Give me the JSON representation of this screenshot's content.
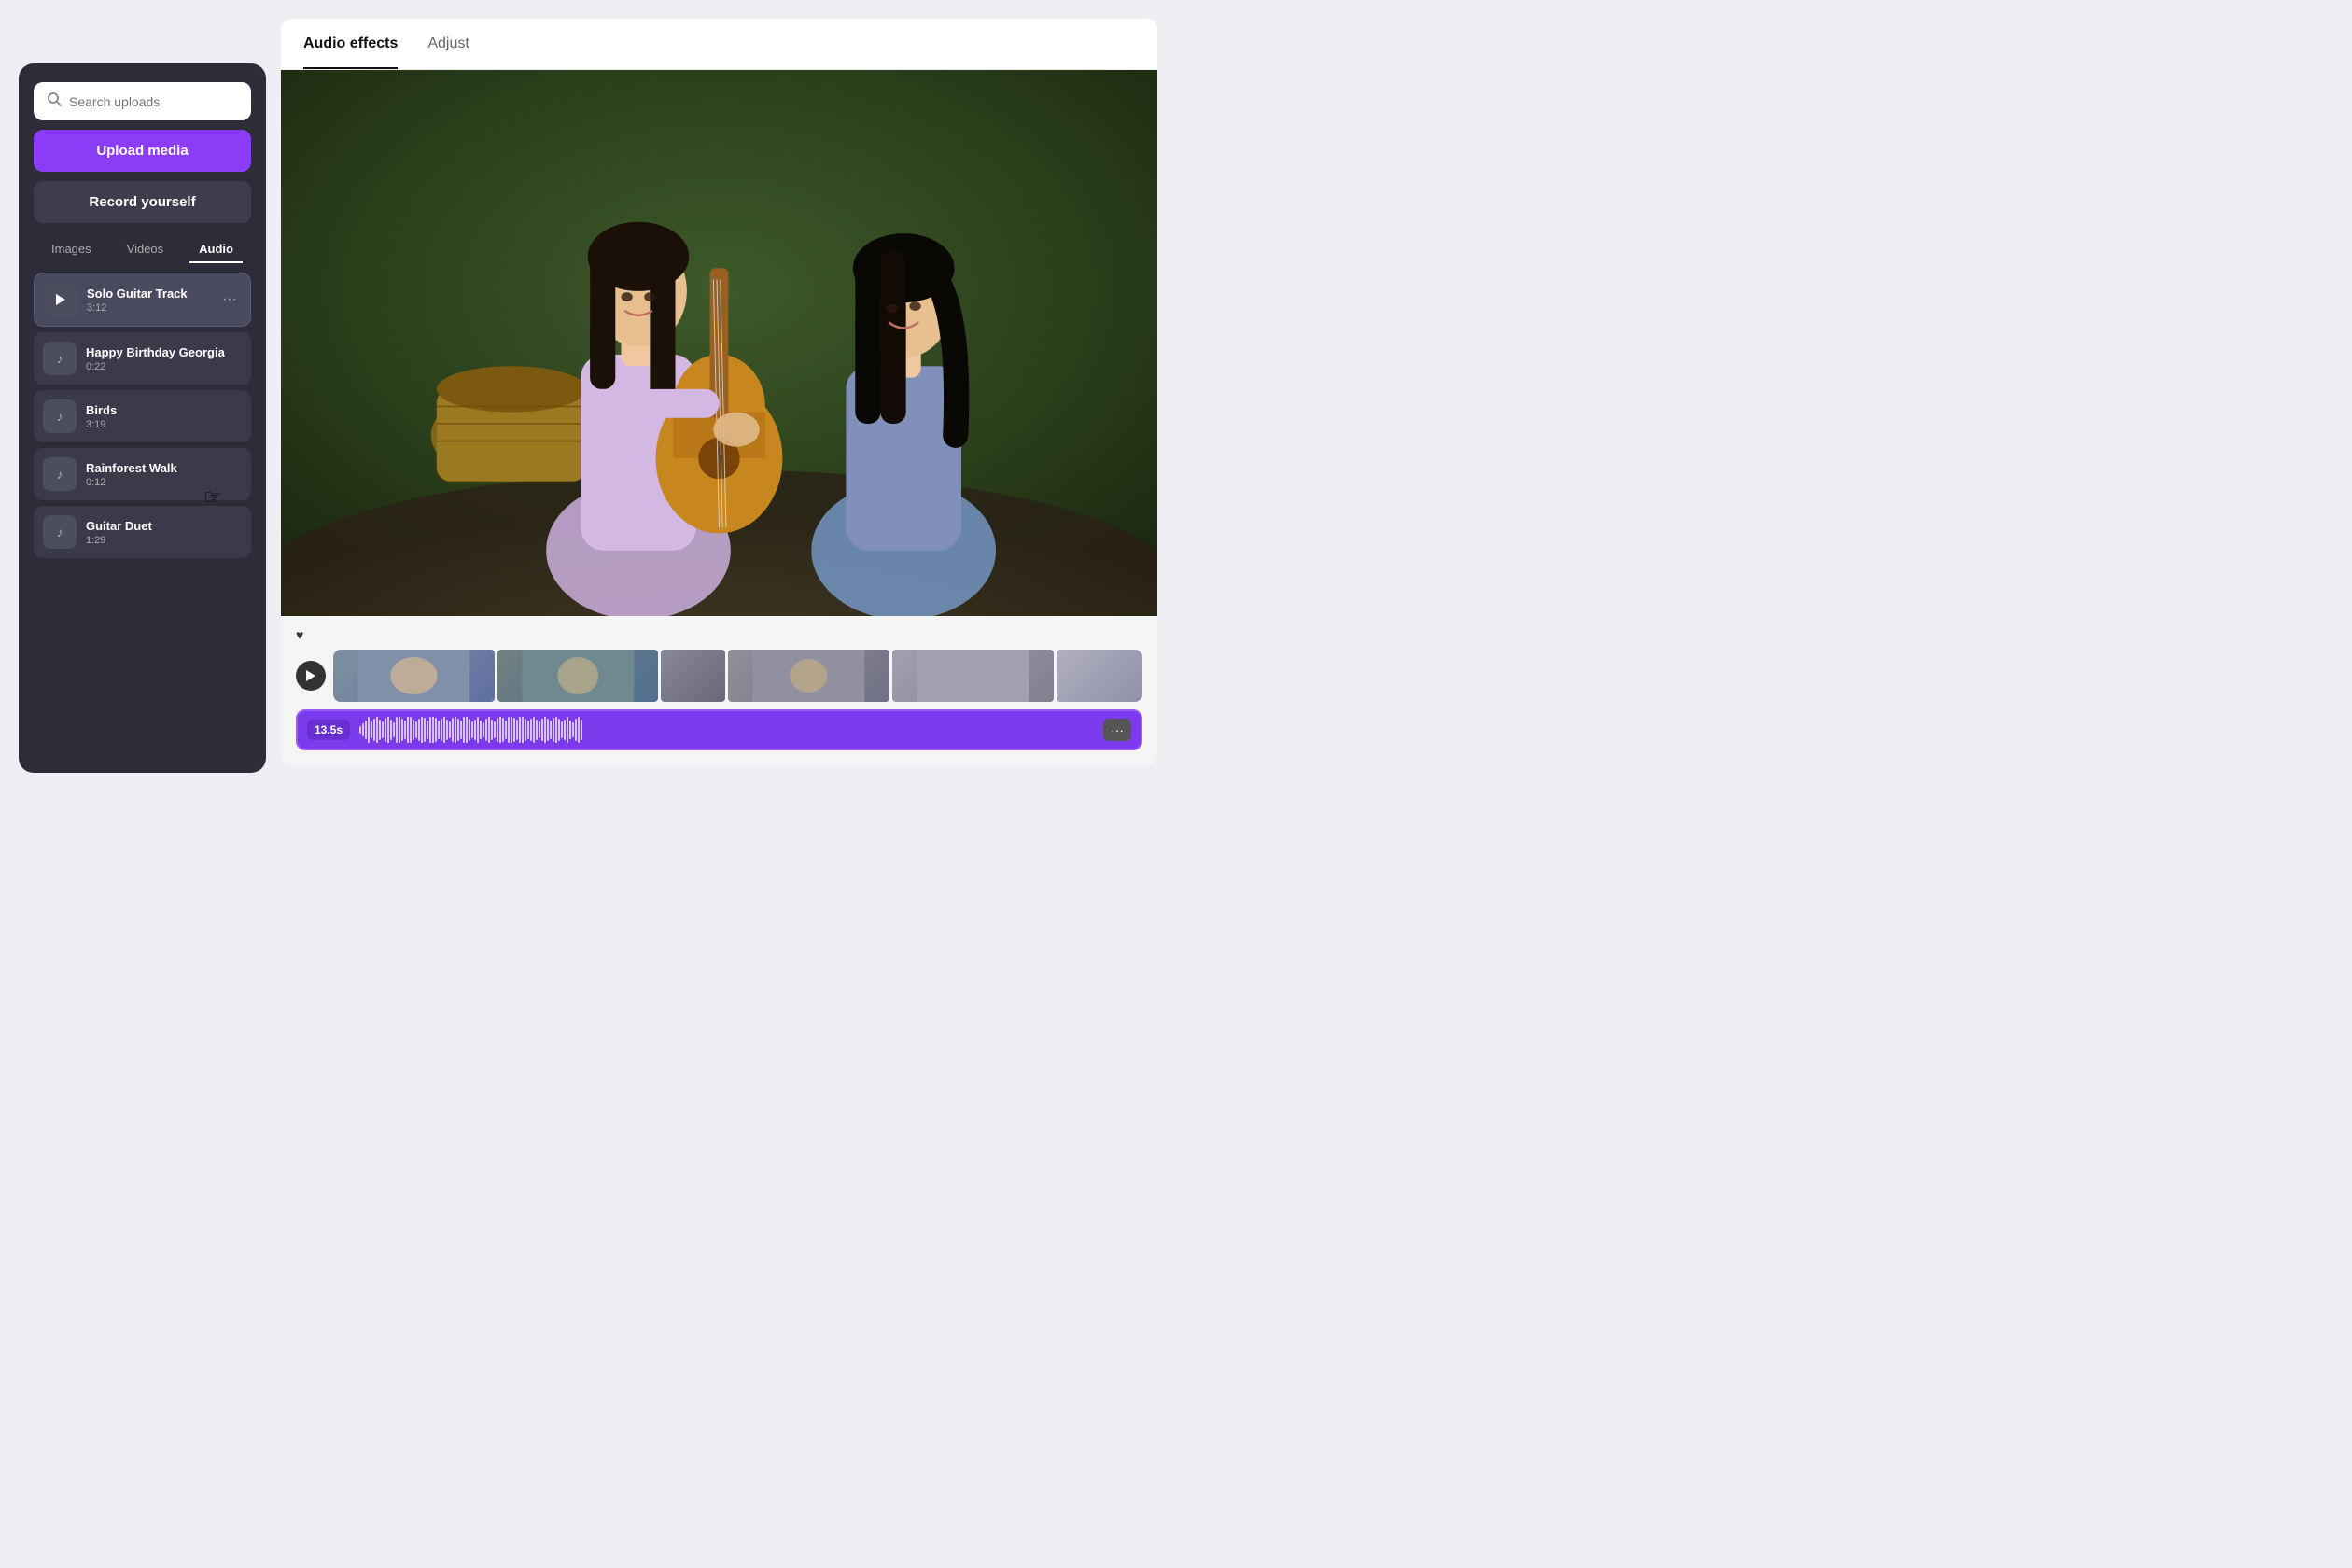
{
  "leftPanel": {
    "search": {
      "placeholder": "Search uploads"
    },
    "uploadBtn": "Upload media",
    "recordBtn": "Record yourself",
    "tabs": [
      {
        "label": "Images",
        "active": false
      },
      {
        "label": "Videos",
        "active": false
      },
      {
        "label": "Audio",
        "active": true
      }
    ],
    "audioItems": [
      {
        "id": 1,
        "title": "Solo Guitar Track",
        "duration": "3:12",
        "active": true,
        "hasPlay": true
      },
      {
        "id": 2,
        "title": "Happy Birthday Georgia",
        "duration": "0:22",
        "active": false,
        "hasPlay": false
      },
      {
        "id": 3,
        "title": "Birds",
        "duration": "3:19",
        "active": false,
        "hasPlay": false
      },
      {
        "id": 4,
        "title": "Rainforest Walk",
        "duration": "0:12",
        "active": false,
        "hasPlay": false
      },
      {
        "id": 5,
        "title": "Guitar Duet",
        "duration": "1:29",
        "active": false,
        "hasPlay": false
      }
    ]
  },
  "rightPanel": {
    "tabs": [
      {
        "label": "Audio effects",
        "active": true
      },
      {
        "label": "Adjust",
        "active": false
      }
    ],
    "timeline": {
      "timeBadge": "13.5s",
      "moreBtn": "···"
    }
  },
  "icons": {
    "search": "🔍",
    "music": "♪",
    "play": "▶",
    "heart": "♥",
    "more": "···"
  }
}
